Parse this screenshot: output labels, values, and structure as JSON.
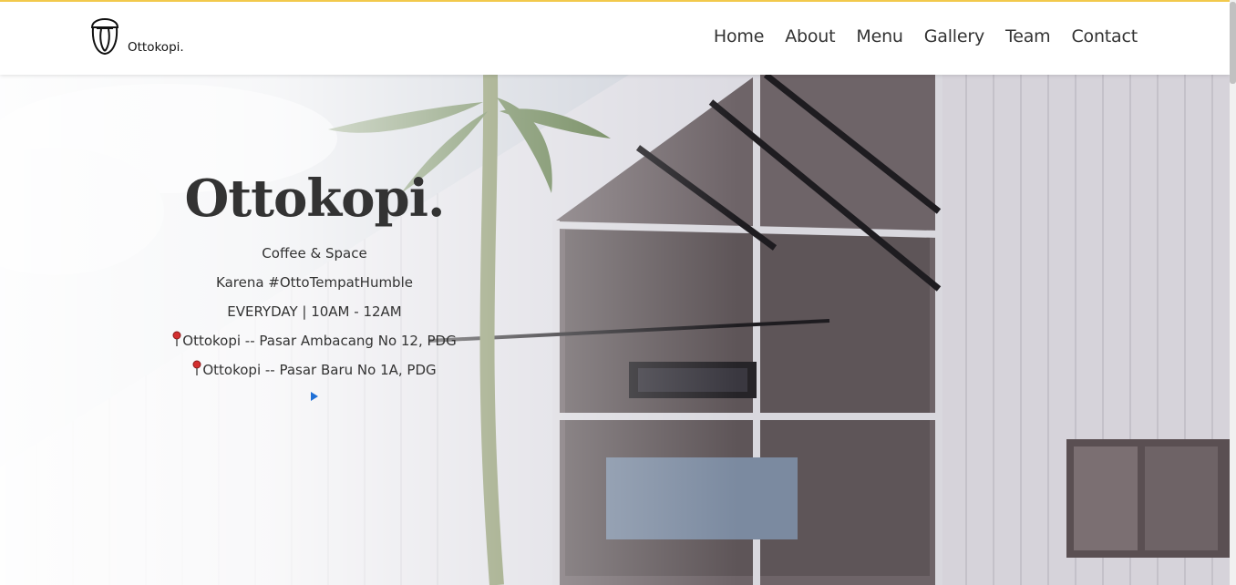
{
  "brand": {
    "name": "Ottokopi."
  },
  "nav": {
    "items": [
      {
        "label": "Home"
      },
      {
        "label": "About"
      },
      {
        "label": "Menu"
      },
      {
        "label": "Gallery"
      },
      {
        "label": "Team"
      },
      {
        "label": "Contact"
      }
    ]
  },
  "hero": {
    "title": "Ottokopi.",
    "tagline": "Coffee & Space",
    "hashtag": "Karena #OttoTempatHumble",
    "hours": "EVERYDAY | 10AM - 12AM",
    "locations": [
      {
        "text": "Ottokopi -- Pasar Ambacang No 12, PDG",
        "icon": "pin-icon"
      },
      {
        "text": "Ottokopi -- Pasar Baru No 1A, PDG",
        "icon": "pin-icon"
      }
    ],
    "play_icon": "play-icon"
  },
  "colors": {
    "accent": "#f2c94c",
    "text": "#333333",
    "pin": "#d32f2f",
    "play": "#1f6fd6"
  }
}
